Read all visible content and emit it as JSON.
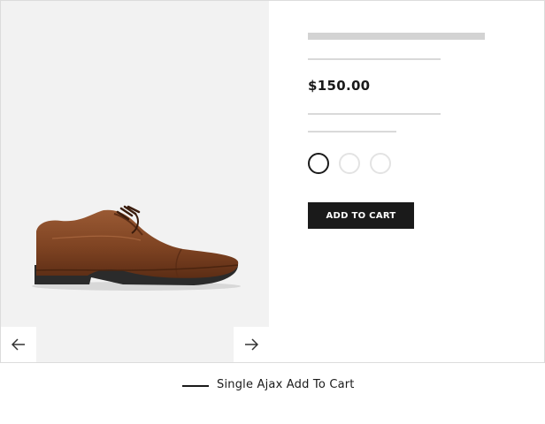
{
  "product": {
    "image": "brown-leather-oxford-shoe",
    "price": "$150.00",
    "add_to_cart_label": "ADD TO CART",
    "swatches": [
      {
        "name": "swatch-1",
        "selected": true
      },
      {
        "name": "swatch-2",
        "selected": false
      },
      {
        "name": "swatch-3",
        "selected": false
      }
    ]
  },
  "gallery_nav": {
    "prev_icon": "arrow-left-icon",
    "next_icon": "arrow-right-icon"
  },
  "caption": {
    "text": "Single Ajax Add To Cart"
  },
  "colors": {
    "gallery_bg": "#f2f2f2",
    "button_bg": "#1a1a1a",
    "button_text": "#ffffff",
    "placeholder": "#d3d3d3"
  }
}
